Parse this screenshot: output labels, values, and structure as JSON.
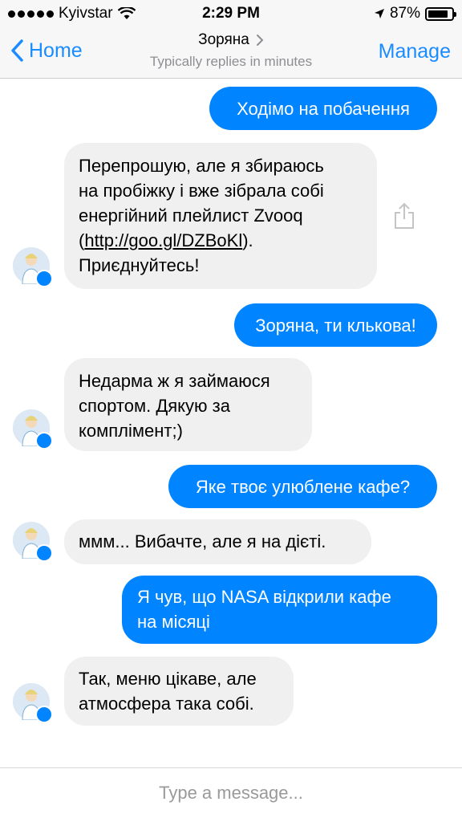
{
  "status_bar": {
    "carrier": "Kyivstar",
    "time": "2:29 PM",
    "battery": "87%",
    "battery_level": 0.87,
    "icons": [
      "signal-dots",
      "wifi-icon",
      "location-arrow-icon",
      "battery-icon"
    ]
  },
  "header": {
    "back_label": "Home",
    "title": "Зоряна",
    "subtitle": "Typically replies in minutes",
    "manage_label": "Manage"
  },
  "messages": [
    {
      "from": "me",
      "text": "Ходімо на побачення"
    },
    {
      "from": "bot",
      "lines": [
        "Перепрошую, але я збираюсь",
        "на пробіжку і вже зібрала собі",
        "енергійний плейлист Zvooq"
      ],
      "link_prefix": "(",
      "link": "http://goo.gl/DZBoKl",
      "link_suffix": ").",
      "last_line": "Приєднуйтесь!"
    },
    {
      "from": "me",
      "text": "Зоряна, ти клькова!"
    },
    {
      "from": "bot",
      "lines": [
        "Недарма ж я займаюся",
        "спортом. Дякую за",
        "комплімент;)"
      ]
    },
    {
      "from": "me",
      "text": "Яке твоє улюблене кафе?"
    },
    {
      "from": "bot",
      "lines": [
        "ммм... Вибачте, але я на дієті."
      ]
    },
    {
      "from": "me",
      "lines": [
        "Я чув, що NASA відкрили кафе",
        "на місяці"
      ]
    },
    {
      "from": "bot",
      "lines": [
        "Так, меню цікаве, але",
        "атмосфера така собі."
      ]
    }
  ],
  "composer": {
    "placeholder": "Type a message..."
  },
  "colors": {
    "accent": "#0084ff",
    "nav_blue": "#1a8cff",
    "incoming_bubble": "#f1f0f0"
  }
}
